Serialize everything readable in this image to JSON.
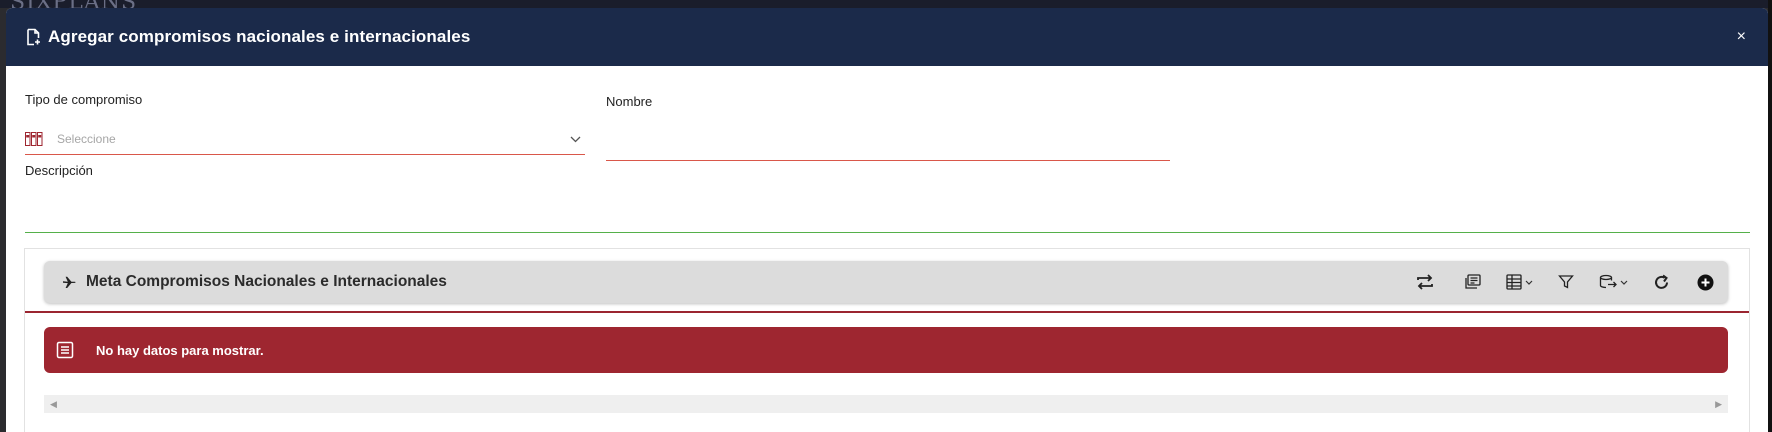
{
  "background": {
    "logo_text": "SIXPLANS"
  },
  "modal": {
    "title": "Agregar compromisos nacionales e internacionales",
    "close_label": "×"
  },
  "form": {
    "tipo_label": "Tipo de compromiso",
    "tipo_placeholder": "Seleccione",
    "nombre_label": "Nombre",
    "nombre_value": "",
    "descripcion_label": "Descripción",
    "descripcion_value": ""
  },
  "panel": {
    "title": "Meta Compromisos Nacionales e Internacionales",
    "toolbar_icons": [
      "transfer-icon",
      "notes-icon",
      "columns-icon",
      "filter-icon",
      "export-icon",
      "refresh-icon",
      "add-icon"
    ]
  },
  "alert": {
    "message": "No hay datos para mostrar."
  },
  "colors": {
    "header_bg": "#1b2a4a",
    "required_underline": "#d9574a",
    "valid_underline": "#55b04a",
    "alert_bg": "#9e2630",
    "panel_header_bg": "#dcdcdc"
  }
}
